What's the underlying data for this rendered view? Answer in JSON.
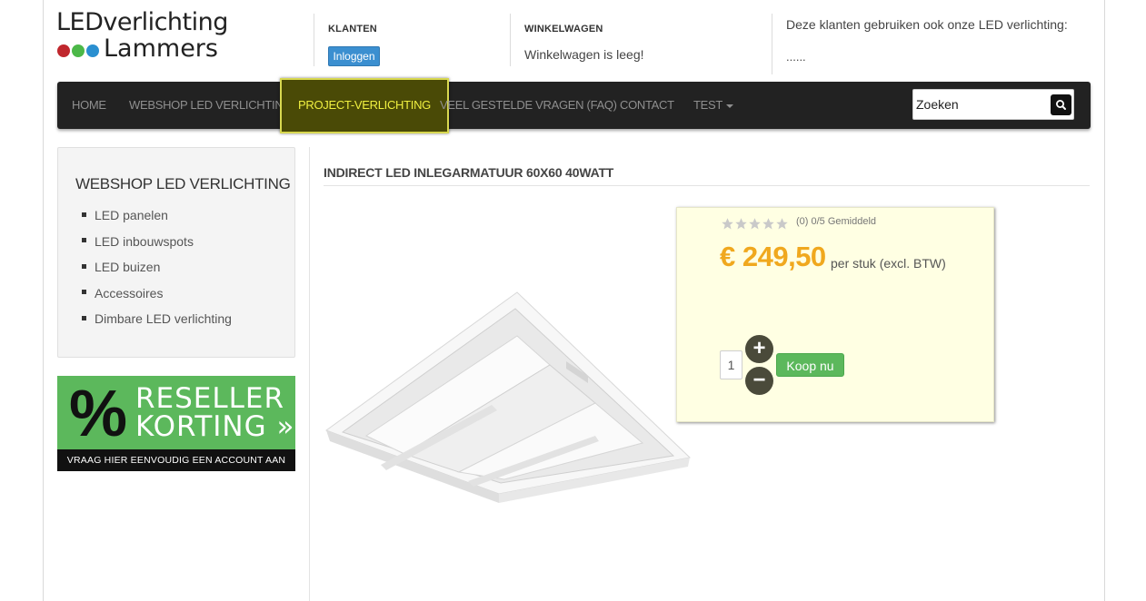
{
  "logo": {
    "line1": "LEDverlichting",
    "line2": "Lammers",
    "dot_colors": [
      "#c0272d",
      "#4cb848",
      "#2a8fd0"
    ]
  },
  "header": {
    "klanten_title": "KLANTEN",
    "login_label": "Inloggen",
    "cart_title": "WINKELWAGEN",
    "cart_status": "Winkelwagen is leeg!",
    "clients_text": "Deze klanten gebruiken ook onze LED verlichting:",
    "clients_placeholder": "......"
  },
  "nav": {
    "items": [
      {
        "label": "HOME"
      },
      {
        "label": "WEBSHOP LED VERLICHTING"
      },
      {
        "label": "PROJECT-VERLICHTING",
        "active": true
      },
      {
        "label": "VEEL GESTELDE VRAGEN (FAQ)"
      },
      {
        "label": "CONTACT"
      },
      {
        "label": "TEST",
        "dropdown": true
      }
    ],
    "search_placeholder": "Zoeken",
    "search_icon": "search-icon"
  },
  "sidebar": {
    "title": "WEBSHOP LED VERLICHTING",
    "items": [
      {
        "label": "LED panelen"
      },
      {
        "label": "LED inbouwspots"
      },
      {
        "label": "LED buizen"
      },
      {
        "label": "Accessoires"
      },
      {
        "label": "Dimbare LED verlichting"
      }
    ],
    "banner": {
      "symbol": "%",
      "line1": "RESELLER",
      "line2": "KORTING »",
      "footer": "VRAAG HIER EENVOUDIG EEN ACCOUNT AAN"
    }
  },
  "product": {
    "title": "INDIRECT LED INLEGARMATUUR 60X60 40WATT",
    "rating_text": "(0) 0/5 Gemiddeld",
    "rating_value": 0,
    "rating_max": 5,
    "price": "€ 249,50",
    "price_unit": "per stuk (excl. BTW)",
    "quantity": "1",
    "plus_label": "+",
    "minus_label": "−",
    "buy_label": "Koop nu"
  },
  "colors": {
    "accent_green": "#5cb85c",
    "price_orange": "#f0a81e",
    "login_blue": "#3b8fd0",
    "nav_active_bg": "#4a4a06",
    "nav_active_text": "#f0f040"
  }
}
